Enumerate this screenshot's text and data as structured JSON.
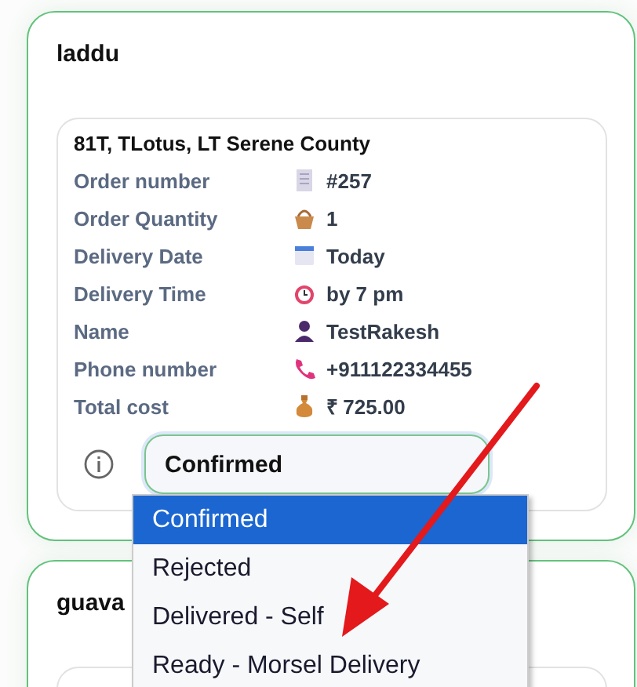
{
  "orders": [
    {
      "title": "laddu",
      "address": "81T, TLotus, LT Serene County",
      "details": [
        {
          "kind": "receipt",
          "label": "Order number",
          "value": "#257"
        },
        {
          "kind": "basket",
          "label": "Order Quantity",
          "value": "1"
        },
        {
          "kind": "calendar",
          "label": "Delivery Date",
          "value": "Today"
        },
        {
          "kind": "clock",
          "label": "Delivery Time",
          "value": "by 7 pm"
        },
        {
          "kind": "person",
          "label": "Name",
          "value": "TestRakesh"
        },
        {
          "kind": "phone",
          "label": "Phone number",
          "value": "+911122334455"
        },
        {
          "kind": "money",
          "label": "Total cost",
          "value": "₹ 725.00"
        }
      ],
      "status": {
        "value": "Confirmed",
        "options": [
          {
            "label": "Confirmed",
            "selected": true
          },
          {
            "label": "Rejected",
            "selected": false
          },
          {
            "label": "Delivered - Self",
            "selected": false
          },
          {
            "label": "Ready - Morsel Delivery",
            "selected": false
          }
        ]
      }
    },
    {
      "title": "guava"
    }
  ]
}
